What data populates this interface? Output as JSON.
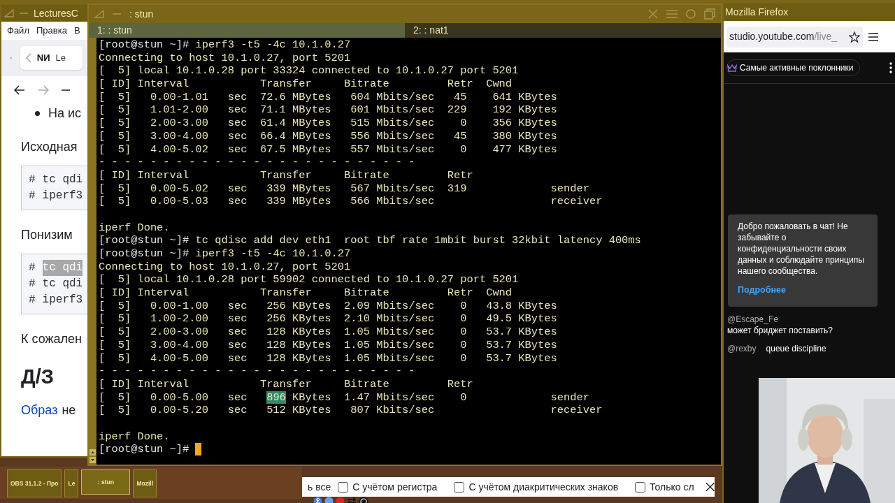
{
  "browser_left": {
    "title": "LecturesC",
    "menu": [
      "Файл",
      "Правка",
      "В"
    ],
    "tab": {
      "logo": "NИ",
      "title": "Le"
    },
    "content": [
      {
        "kind": "bullet",
        "text": "На ис"
      },
      {
        "kind": "para",
        "text": "Исходная"
      },
      {
        "kind": "code",
        "lines": [
          {
            "hash": "#",
            "text": "tc qdi",
            "selected": false
          },
          {
            "hash": "#",
            "text": "iperf3",
            "selected": false
          }
        ]
      },
      {
        "kind": "para",
        "text": "Понизим"
      },
      {
        "kind": "code",
        "lines": [
          {
            "hash": "#",
            "text": "tc qdi",
            "selected": true
          },
          {
            "hash": "#",
            "text": "tc qdi",
            "selected": false
          },
          {
            "hash": "#",
            "text": "iperf3",
            "selected": false
          }
        ]
      },
      {
        "kind": "para",
        "text": "К сожален"
      },
      {
        "kind": "heading",
        "text": "Д/З"
      },
      {
        "kind": "linkpara",
        "link": "Образ",
        "text": "не"
      }
    ]
  },
  "terminal": {
    "title": ": stun",
    "tabs": [
      {
        "label": "1: : stun",
        "selected": true
      },
      {
        "label": "2: : nat1",
        "selected": false
      }
    ],
    "lines": [
      {
        "kind": "prompt",
        "prompt": "[root@stun ~]#",
        "command": "iperf3 -t5 -4c 10.1.0.27"
      },
      {
        "kind": "output",
        "text": "Connecting to host 10.1.0.27, port 5201"
      },
      {
        "kind": "output",
        "text": "[  5] local 10.1.0.28 port 33324 connected to 10.1.0.27 port 5201"
      },
      {
        "kind": "output",
        "text": "[ ID] Interval           Transfer     Bitrate         Retr  Cwnd"
      },
      {
        "kind": "output",
        "text": "[  5]   0.00-1.01   sec  72.6 MBytes   604 Mbits/sec   45    641 KBytes"
      },
      {
        "kind": "output",
        "text": "[  5]   1.01-2.00   sec  71.1 MBytes   601 Mbits/sec  229    192 KBytes"
      },
      {
        "kind": "output",
        "text": "[  5]   2.00-3.00   sec  61.4 MBytes   515 Mbits/sec    0    356 KBytes"
      },
      {
        "kind": "output",
        "text": "[  5]   3.00-4.00   sec  66.4 MBytes   556 Mbits/sec   45    380 KBytes"
      },
      {
        "kind": "output",
        "text": "[  5]   4.00-5.02   sec  67.5 MBytes   557 Mbits/sec    0    477 KBytes"
      },
      {
        "kind": "output",
        "text": "- - - - - - - - - - - - - - - - - - - - - - - - -"
      },
      {
        "kind": "output",
        "text": "[ ID] Interval           Transfer     Bitrate         Retr"
      },
      {
        "kind": "output",
        "text": "[  5]   0.00-5.02   sec   339 MBytes   567 Mbits/sec  319             sender"
      },
      {
        "kind": "output",
        "text": "[  5]   0.00-5.03   sec   339 MBytes   566 Mbits/sec                  receiver"
      },
      {
        "kind": "blank"
      },
      {
        "kind": "output",
        "text": "iperf Done."
      },
      {
        "kind": "prompt",
        "prompt": "[root@stun ~]#",
        "command": "tc qdisc add dev eth1  root tbf rate 1mbit burst 32kbit latency 400ms"
      },
      {
        "kind": "prompt",
        "prompt": "[root@stun ~]#",
        "command": "iperf3 -t5 -4c 10.1.0.27"
      },
      {
        "kind": "output",
        "text": "Connecting to host 10.1.0.27, port 5201"
      },
      {
        "kind": "output",
        "text": "[  5] local 10.1.0.28 port 59902 connected to 10.1.0.27 port 5201"
      },
      {
        "kind": "output",
        "text": "[ ID] Interval           Transfer     Bitrate         Retr  Cwnd"
      },
      {
        "kind": "output",
        "text": "[  5]   0.00-1.00   sec   256 KBytes  2.09 Mbits/sec    0   43.8 KBytes"
      },
      {
        "kind": "output",
        "text": "[  5]   1.00-2.00   sec   256 KBytes  2.10 Mbits/sec    0   49.5 KBytes"
      },
      {
        "kind": "output",
        "text": "[  5]   2.00-3.00   sec   128 KBytes  1.05 Mbits/sec    0   53.7 KBytes"
      },
      {
        "kind": "output",
        "text": "[  5]   3.00-4.00   sec   128 KBytes  1.05 Mbits/sec    0   53.7 KBytes"
      },
      {
        "kind": "output",
        "text": "[  5]   4.00-5.00   sec   128 KBytes  1.05 Mbits/sec    0   53.7 KBytes"
      },
      {
        "kind": "output",
        "text": "- - - - - - - - - - - - - - - - - - - - - - - - -"
      },
      {
        "kind": "output",
        "text": "[ ID] Interval           Transfer     Bitrate         Retr"
      },
      {
        "kind": "segmented",
        "segments": [
          {
            "text": "[  5]   0.00-5.00   sec   ",
            "selected": false
          },
          {
            "text": "896",
            "selected": true
          },
          {
            "text": " KBytes  1.47 Mbits/sec    0             sender",
            "selected": false
          }
        ]
      },
      {
        "kind": "output",
        "text": "[  5]   0.00-5.20   sec   512 KBytes   807 Kbits/sec                  receiver"
      },
      {
        "kind": "blank"
      },
      {
        "kind": "output",
        "text": "iperf Done."
      },
      {
        "kind": "prompt",
        "prompt": "[root@stun ~]#"
      }
    ]
  },
  "firefox": {
    "title": "Mozilla Firefox",
    "url_host": "studio.youtube.com",
    "url_path": "/live_",
    "chat_header": "Самые активные поклонники",
    "welcome": {
      "text": "Добро пожаловать в чат! Не забывайте о конфиденциальности своих данных и соблюдайте принципы нашего сообщества.",
      "link": "Подробнее"
    },
    "messages": [
      {
        "author": "@Escape_Fe",
        "text": "может бриджет поставить?"
      },
      {
        "author": "@rexby",
        "text": "queue discipline"
      }
    ]
  },
  "taskbar": {
    "items": [
      {
        "label": "OBS 31.1.2 - Про",
        "selected": false
      },
      {
        "label": "Le",
        "selected": false
      },
      {
        "label": ": stun",
        "selected": true
      },
      {
        "label": "Mozill",
        "selected": false
      }
    ]
  },
  "find_bar": {
    "partial": "ь все",
    "options": [
      {
        "label": "С учётом регистра",
        "checked": false
      },
      {
        "label": "С учётом диакритических знаков",
        "checked": false
      },
      {
        "label": "Только сл",
        "checked": false
      }
    ]
  }
}
